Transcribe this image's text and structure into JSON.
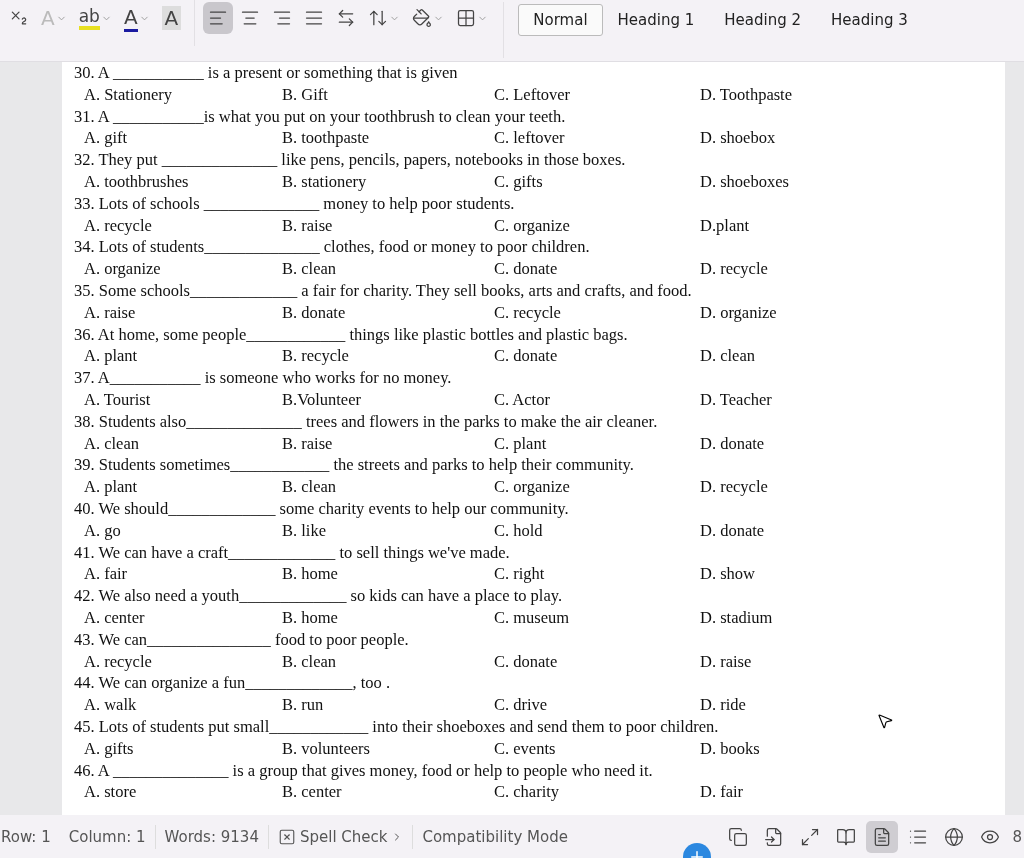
{
  "toolbar": {
    "tools": [
      {
        "kind": "subscript",
        "dropdown": false,
        "selected": false
      },
      {
        "kind": "text-effect",
        "label": "A",
        "dropdown": true,
        "selected": false
      },
      {
        "kind": "highlight",
        "label": "ab",
        "dropdown": true,
        "selected": false
      },
      {
        "kind": "font-color",
        "label": "A",
        "dropdown": true,
        "selected": false
      },
      {
        "kind": "char-shading",
        "label": "A",
        "dropdown": false,
        "selected": false
      },
      {
        "kind": "align-left",
        "dropdown": false,
        "selected": true
      },
      {
        "kind": "align-center",
        "dropdown": false,
        "selected": false
      },
      {
        "kind": "align-right",
        "dropdown": false,
        "selected": false
      },
      {
        "kind": "justify",
        "dropdown": false,
        "selected": false
      },
      {
        "kind": "distribute",
        "dropdown": false,
        "selected": false
      },
      {
        "kind": "line-spacing",
        "dropdown": true,
        "selected": false
      },
      {
        "kind": "shading",
        "dropdown": true,
        "selected": false
      },
      {
        "kind": "borders",
        "dropdown": true,
        "selected": false
      }
    ],
    "styles": [
      {
        "label": "Normal",
        "selected": true
      },
      {
        "label": "Heading 1",
        "selected": false
      },
      {
        "label": "Heading 2",
        "selected": false
      },
      {
        "label": "Heading 3",
        "selected": false
      }
    ]
  },
  "questions": [
    {
      "text": "30. A ___________ is a present or something that is given",
      "options": [
        "A. Stationery",
        "B. Gift",
        "C. Leftover",
        "D. Toothpaste"
      ]
    },
    {
      "text": "31. A ___________is what you put on your toothbrush to clean your teeth.",
      "options": [
        "A. gift",
        "B. toothpaste",
        "C. leftover",
        "D. shoebox"
      ]
    },
    {
      "text": "32. They put ______________ like pens, pencils, papers, notebooks in those boxes.",
      "options": [
        "A. toothbrushes",
        "B. stationery",
        "C. gifts",
        "D. shoeboxes"
      ]
    },
    {
      "text": "33. Lots of schools ______________ money to help poor students.",
      "options": [
        "A. recycle",
        "B. raise",
        "C. organize",
        "D.plant"
      ]
    },
    {
      "text": "34. Lots of students______________ clothes, food or money to poor children.",
      "options": [
        "A. organize",
        "B. clean",
        "C. donate",
        "D. recycle"
      ]
    },
    {
      "text": "35. Some schools_____________ a fair for charity. They sell books, arts and crafts, and food.",
      "options": [
        "A. raise",
        "B. donate",
        "C. recycle",
        "D. organize"
      ]
    },
    {
      "text": "36. At home, some people____________ things like plastic bottles and plastic bags.",
      "options": [
        "A. plant",
        "B. recycle",
        "C. donate",
        "D. clean"
      ]
    },
    {
      "text": "37. A___________ is someone who works for no money.",
      "options": [
        "A. Tourist",
        "B.Volunteer",
        "C. Actor",
        "D. Teacher"
      ]
    },
    {
      "text": "38. Students also______________ trees and flowers in the parks to make the air cleaner.",
      "options": [
        "A. clean",
        "B. raise",
        "C. plant",
        "D. donate"
      ]
    },
    {
      "text": "39. Students sometimes____________ the streets and parks to help their community.",
      "options": [
        "A. plant",
        "B. clean",
        "C. organize",
        "D. recycle"
      ]
    },
    {
      "text": "40. We should_____________ some charity events to help our community.",
      "options": [
        "A. go",
        "B. like",
        "C. hold",
        "D. donate"
      ]
    },
    {
      "text": "41. We can have a craft_____________ to sell things we've made.",
      "options": [
        "A. fair",
        "B. home",
        "C. right",
        "D. show"
      ]
    },
    {
      "text": "42. We also need a youth_____________ so kids can have a place to play.",
      "options": [
        "A. center",
        "B. home",
        "C. museum",
        "D. stadium"
      ]
    },
    {
      "text": "43. We can_______________ food to poor people.",
      "options": [
        "A. recycle",
        "B. clean",
        "C. donate",
        "D. raise"
      ]
    },
    {
      "text": "44. We can organize a fun_____________, too .",
      "options": [
        "A. walk",
        "B. run",
        "C. drive",
        "D. ride"
      ]
    },
    {
      "text": "45. Lots of students put small____________ into their shoeboxes and send them to poor children.",
      "options": [
        "A. gifts",
        "B. volunteers",
        "C. events",
        "D. books"
      ]
    },
    {
      "text": "46. A ______________ is a group that gives money, food or help to people who need it.",
      "options": [
        "A. store",
        "B. center",
        "C. charity",
        "D. fair"
      ]
    }
  ],
  "status_bar": {
    "row": "Row: 1",
    "column": "Column: 1",
    "words": "Words: 9134",
    "spell_check": "Spell Check",
    "mode": "Compatibility Mode",
    "views": [
      {
        "kind": "outline",
        "selected": false
      },
      {
        "kind": "import",
        "selected": false
      },
      {
        "kind": "fullscreen",
        "selected": false
      },
      {
        "kind": "reading",
        "selected": false
      },
      {
        "kind": "page",
        "selected": true
      },
      {
        "kind": "list",
        "selected": false
      },
      {
        "kind": "web",
        "selected": false
      },
      {
        "kind": "eye",
        "selected": false
      }
    ],
    "zoom": "8"
  }
}
